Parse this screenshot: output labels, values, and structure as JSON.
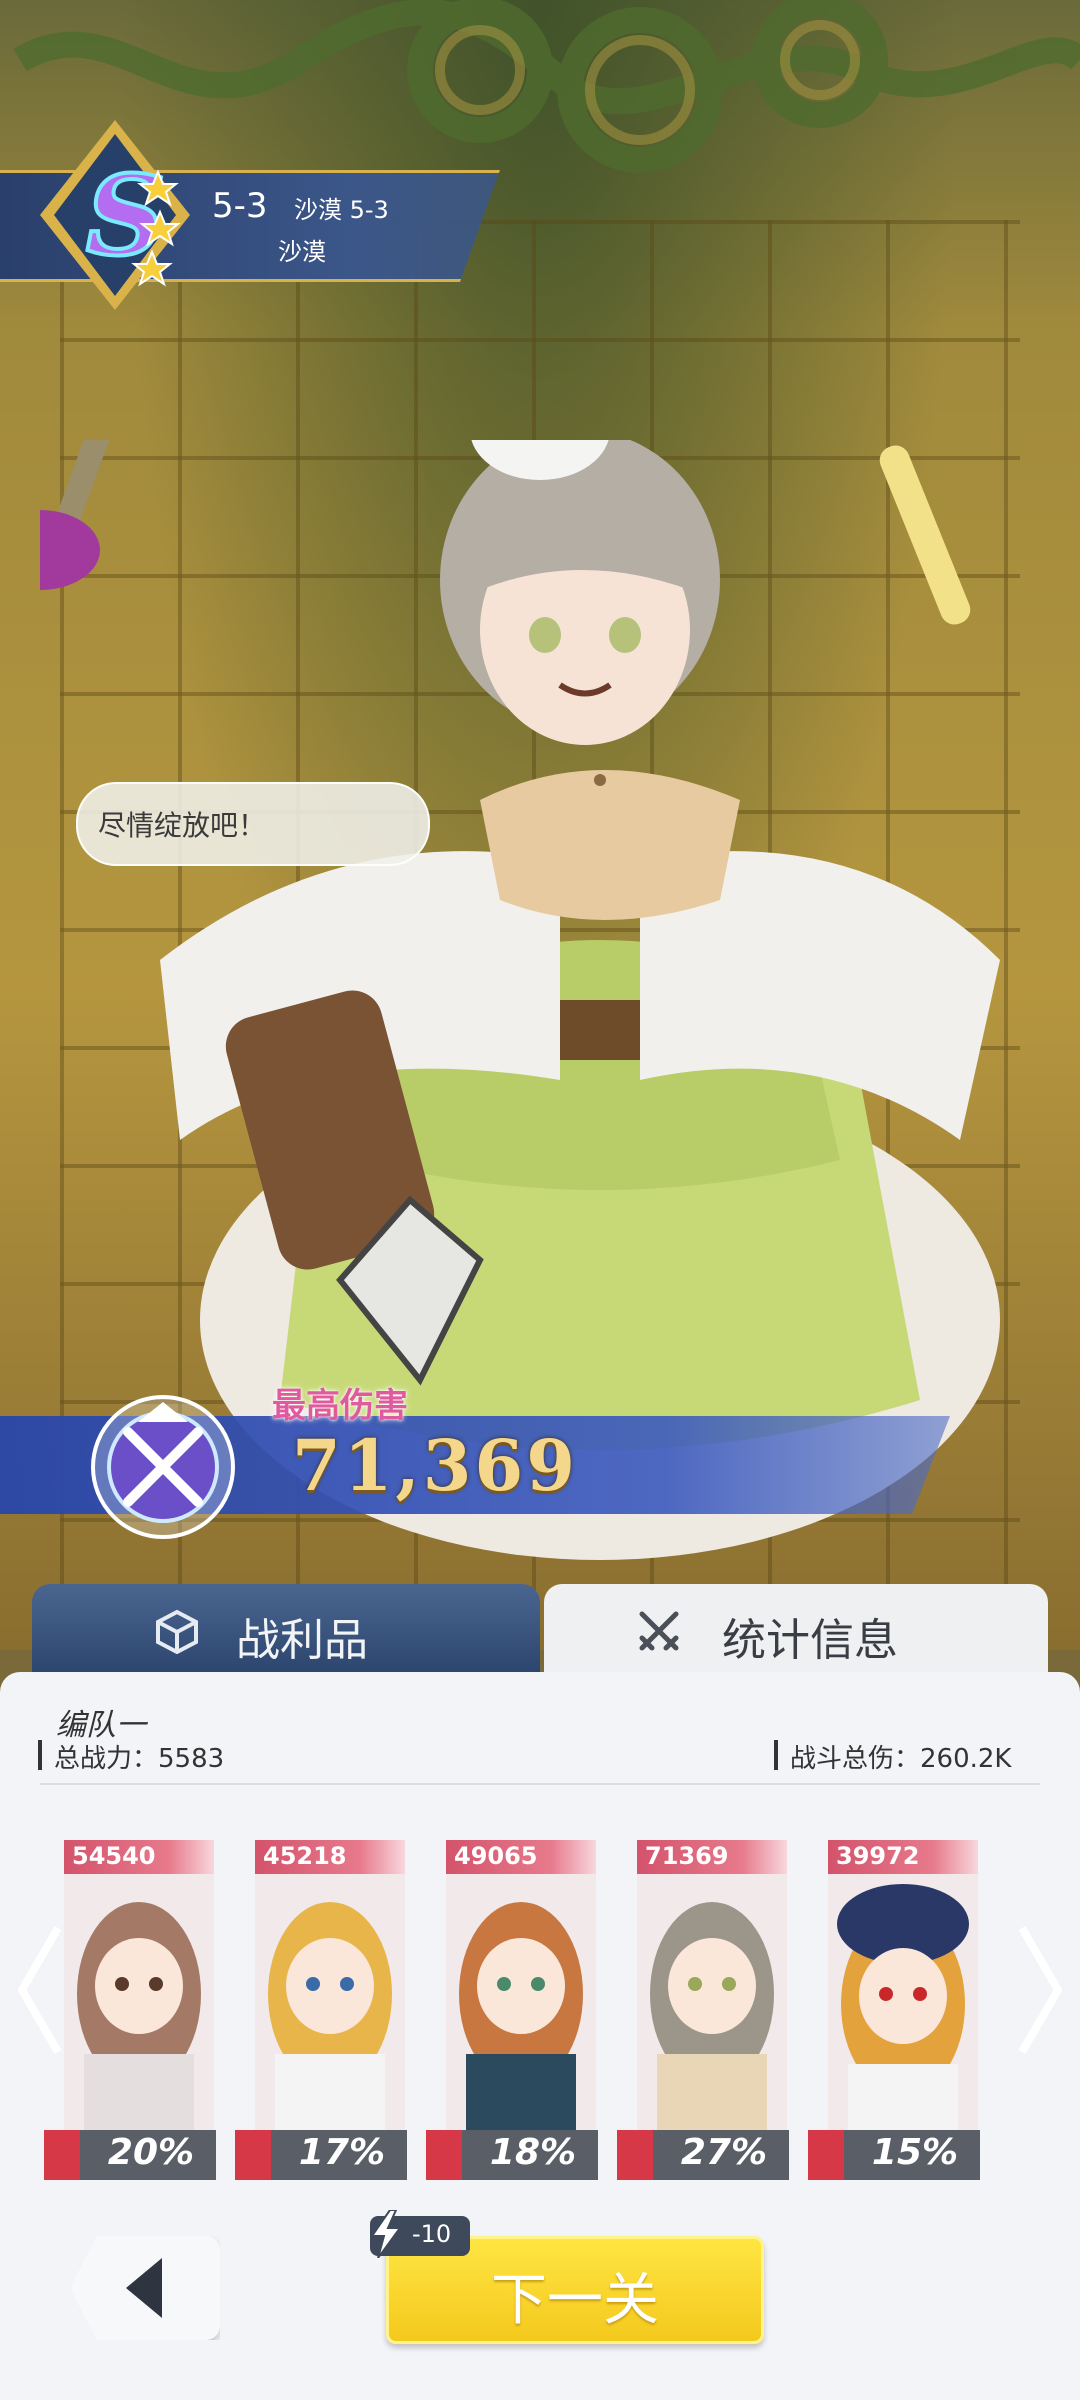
{
  "stage": {
    "code": "5-3",
    "name": "沙漠 5-3",
    "subtitle": "沙漠",
    "rank": "S",
    "stars": 3
  },
  "speech": {
    "text": "尽情绽放吧！"
  },
  "damage": {
    "label": "最高伤害",
    "value": "71,369"
  },
  "tabs": [
    {
      "label": "战利品",
      "icon": "cube-icon",
      "active": false
    },
    {
      "label": "统计信息",
      "icon": "crossed-swords-icon",
      "active": true
    }
  ],
  "stats": {
    "team_name": "编队一",
    "total_power": "总战力：5583",
    "total_damage": "战斗总伤：260.2K"
  },
  "members": [
    {
      "damage": "54540",
      "share": "20%",
      "hair": "#a47a66"
    },
    {
      "damage": "45218",
      "share": "17%",
      "hair": "#e8b54a"
    },
    {
      "damage": "49065",
      "share": "18%",
      "hair": "#c7773f"
    },
    {
      "damage": "71369",
      "share": "27%",
      "hair": "#9c958a"
    },
    {
      "damage": "39972",
      "share": "15%",
      "hair": "#e3a23c"
    }
  ],
  "energy_cost": "-10",
  "next_button": "下一关",
  "colors": {
    "accent_yellow": "#f4c91d",
    "tab_blue": "#2c456e",
    "damage_gold": "#f4d78a"
  }
}
